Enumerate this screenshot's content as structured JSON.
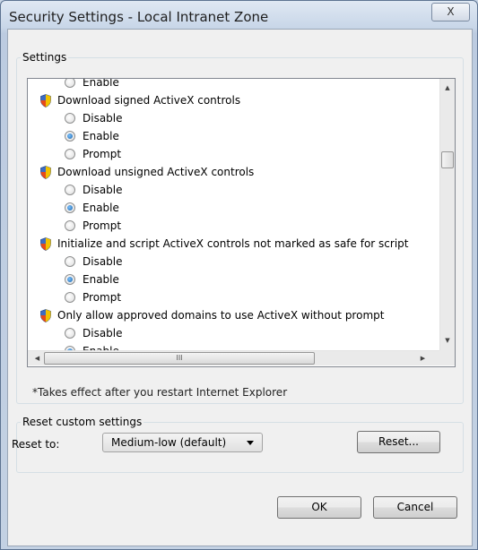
{
  "window": {
    "title": "Security Settings - Local Intranet Zone",
    "close_label": "X"
  },
  "settings": {
    "group_label": "Settings",
    "rows": [
      {
        "kind": "radio",
        "label": "Enable",
        "checked": false
      },
      {
        "kind": "setting",
        "label": "Download signed ActiveX controls",
        "icon": "shield-icon"
      },
      {
        "kind": "radio",
        "label": "Disable",
        "checked": false
      },
      {
        "kind": "radio",
        "label": "Enable",
        "checked": true
      },
      {
        "kind": "radio",
        "label": "Prompt",
        "checked": false
      },
      {
        "kind": "setting",
        "label": "Download unsigned ActiveX controls",
        "icon": "shield-icon"
      },
      {
        "kind": "radio",
        "label": "Disable",
        "checked": false
      },
      {
        "kind": "radio",
        "label": "Enable",
        "checked": true
      },
      {
        "kind": "radio",
        "label": "Prompt",
        "checked": false
      },
      {
        "kind": "setting",
        "label": "Initialize and script ActiveX controls not marked as safe for script",
        "icon": "shield-icon"
      },
      {
        "kind": "radio",
        "label": "Disable",
        "checked": false
      },
      {
        "kind": "radio",
        "label": "Enable",
        "checked": true
      },
      {
        "kind": "radio",
        "label": "Prompt",
        "checked": false
      },
      {
        "kind": "setting",
        "label": "Only allow approved domains to use ActiveX without prompt",
        "icon": "shield-icon"
      },
      {
        "kind": "radio",
        "label": "Disable",
        "checked": false
      },
      {
        "kind": "radio",
        "label": "Enable",
        "checked": true
      }
    ],
    "hscroll_grip": "III",
    "note": "*Takes effect after you restart Internet Explorer"
  },
  "reset": {
    "group_label": "Reset custom settings",
    "reset_to_label": "Reset to:",
    "selected_value": "Medium-low (default)",
    "reset_button": "Reset..."
  },
  "buttons": {
    "ok": "OK",
    "cancel": "Cancel"
  }
}
